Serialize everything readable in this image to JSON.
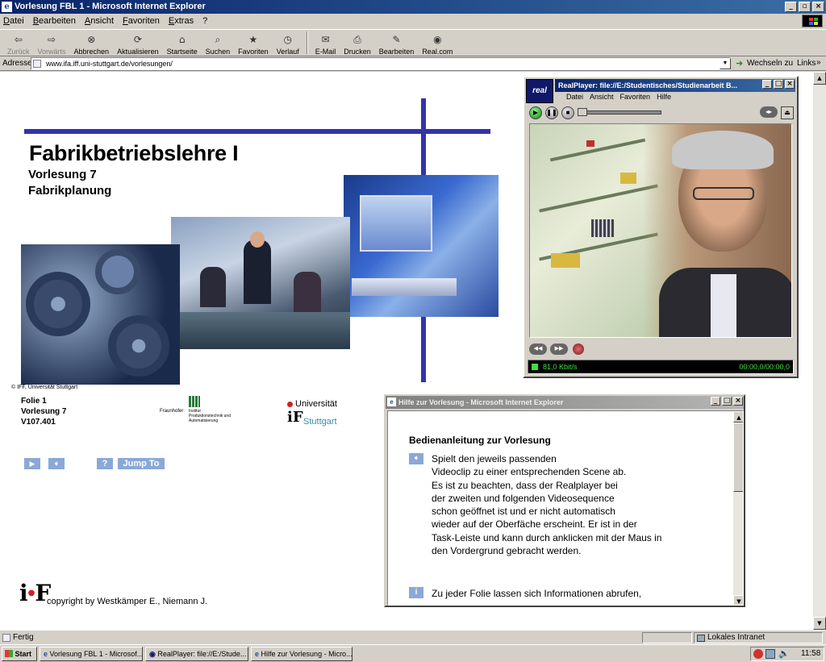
{
  "browser": {
    "title": "Vorlesung FBL 1 - Microsoft Internet Explorer",
    "menu": [
      "Datei",
      "Bearbeiten",
      "Ansicht",
      "Favoriten",
      "Extras",
      "?"
    ],
    "toolbar": [
      "Zurück",
      "Vorwärts",
      "Abbrechen",
      "Aktualisieren",
      "Startseite",
      "Suchen",
      "Favoriten",
      "Verlauf",
      "E-Mail",
      "Drucken",
      "Bearbeiten",
      "Real.com"
    ],
    "address_label": "Adresse",
    "address_url": "www.ifa.iff.uni-stuttgart.de/vorlesungen/",
    "go_label": "Wechseln zu",
    "links_label": "Links",
    "status_text": "Fertig",
    "zone_text": "Lokales Intranet"
  },
  "slide": {
    "title": "Fabrikbetriebslehre I",
    "lecture": "Vorlesung 7",
    "topic": "Fabrikplanung",
    "photo_credit": "© IFF, Universität Stuttgart",
    "folie": "Folie 1",
    "folie_lecture": "Vorlesung 7",
    "code": "V107.401",
    "fraunhofer": "Fraunhofer",
    "fraunhofer_inst1": "Institut",
    "fraunhofer_inst2": "Produktionstechnik und",
    "fraunhofer_inst3": "Automatisierung",
    "uni_line1": "Universität",
    "uni_line2": "Stuttgart",
    "jump_label": "Jump To",
    "help_symbol": "?",
    "copyright": "copyright by Westkämper E., Niemann J."
  },
  "realplayer": {
    "title": "RealPlayer: file://E:/Studentisches/Studienarbeit B...",
    "logo": "real",
    "menu": [
      "Datei",
      "Ansicht",
      "Favoriten",
      "Hilfe"
    ],
    "bitrate": "81,0 Kbit/s",
    "time": "00:00,0/00:00,0"
  },
  "help": {
    "title": "Hilfe zur Vorlesung - Microsoft Internet Explorer",
    "heading": "Bedienanleitung zur Vorlesung",
    "p1": [
      "Spielt den jeweils passenden",
      "Videoclip zu einer entsprechenden Scene ab.",
      "Es ist zu beachten, dass der Realplayer bei",
      "der zweiten und folgenden Videosequence",
      "schon geöffnet ist und er nicht automatisch",
      "wieder auf der Oberfäche erscheint. Er ist in der",
      "Task-Leiste und kann durch anklicken mit der Maus in",
      "den Vordergrund gebracht werden."
    ],
    "p2": "Zu jeder Folie lassen sich Informationen abrufen,"
  },
  "taskbar": {
    "start": "Start",
    "items": [
      "Vorlesung FBL 1 - Microsof...",
      "RealPlayer: file://E:/Stude...",
      "Hilfe zur Vorlesung - Micro..."
    ],
    "clock": "11:58"
  },
  "colors": {
    "accent": "#3333aa",
    "nav": "#8aa8d8",
    "title": "#0a246a"
  }
}
